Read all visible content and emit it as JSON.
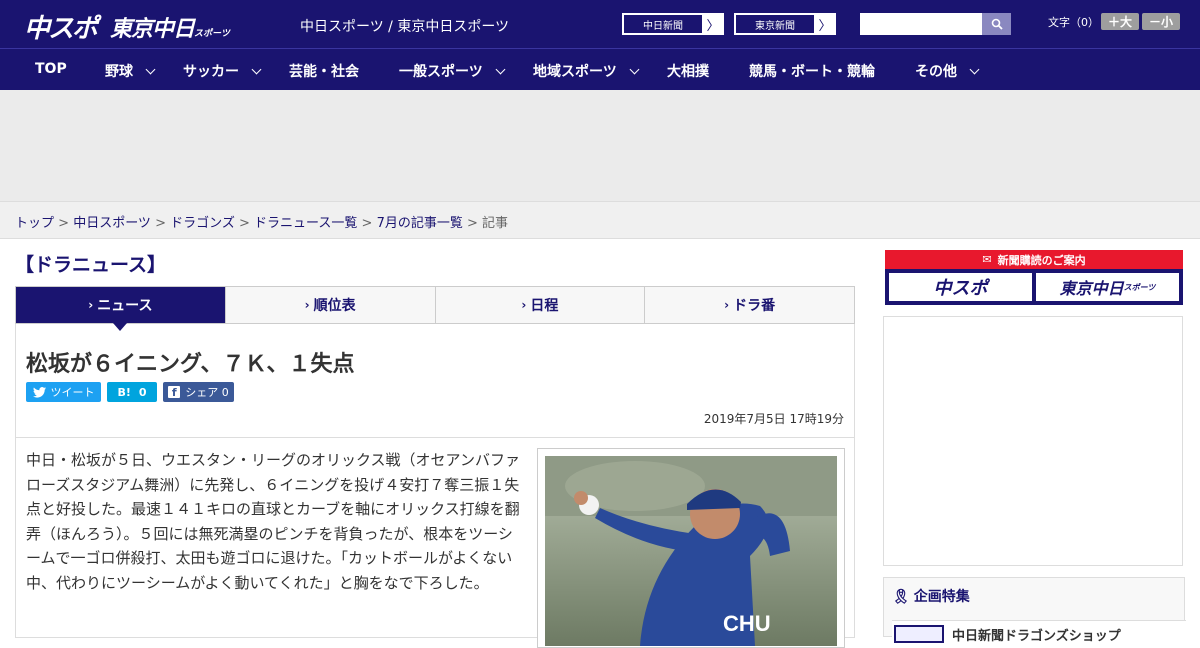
{
  "header": {
    "logo_chuspo": "中スポ",
    "logo_tokyo": "東京中日",
    "logo_tokyo_suffix": "スポーツ",
    "site_name": "中日スポーツ / 東京中日スポーツ",
    "link_chunichi": "中日新聞",
    "link_tokyo": "東京新聞",
    "arrow": "〉",
    "search_placeholder": "",
    "font_size_label": "文字（0）",
    "font_up": "＋大",
    "font_down": "－小"
  },
  "nav": {
    "items": [
      "TOP",
      "野球",
      "サッカー",
      "芸能・社会",
      "一般スポーツ",
      "地域スポーツ",
      "大相撲",
      "競馬・ボート・競輪",
      "その他"
    ]
  },
  "breadcrumb": {
    "items": [
      "トップ",
      "中日スポーツ",
      "ドラゴンズ",
      "ドラニュース一覧",
      "7月の記事一覧"
    ],
    "current": "記事",
    "sep": " > "
  },
  "section_title": "【ドラニュース】",
  "tabs": [
    "ニュース",
    "順位表",
    "日程",
    "ドラ番"
  ],
  "article": {
    "title": "松坂が６イニング、７Ｋ、１失点",
    "tweet": "ツイート",
    "hatena_count": "0",
    "hatena_label": "B!",
    "share": "シェア 0",
    "date": "2019年7月5日 17時19分",
    "body": "中日・松坂が５日、ウエスタン・リーグのオリックス戦（オセアンバファローズスタジアム舞洲）に先発し、６イニングを投げ４安打７奪三振１失点と好投した。最速１４１キロの直球とカーブを軸にオリックス打線を翻弄（ほんろう）。５回には無死満塁のピンチを背負ったが、根本をツーシームで一ゴロ併殺打、太田も遊ゴロに退けた。「カットボールがよくない中、代わりにツーシームがよく動いてくれた」と胸をなで下ろした。",
    "photo_text": "CHU"
  },
  "sidebar": {
    "subscription_label": "新聞購読のご案内",
    "chuspo": "中スポ",
    "tokyo": "東京中日",
    "tokyo_suffix": "スポーツ",
    "feature_title": "企画特集",
    "feature_item": "中日新聞ドラゴンズショップ"
  },
  "colors": {
    "brand": "#1a1470",
    "accent_red": "#e8182d",
    "twitter": "#1da1f2",
    "hatena": "#00a4de",
    "facebook": "#3b5998"
  }
}
